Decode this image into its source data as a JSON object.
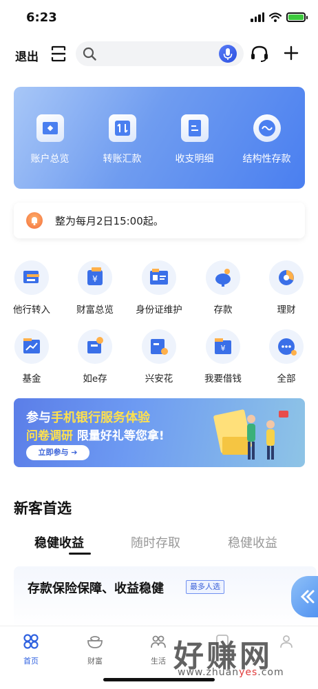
{
  "status": {
    "time": "6:23"
  },
  "header": {
    "logout_label": "退出",
    "search_placeholder": "",
    "icons": [
      "scan-icon",
      "search-icon",
      "mic-icon",
      "headset-icon",
      "plus-icon"
    ]
  },
  "banner": {
    "items": [
      {
        "label": "账户总览",
        "icon": "wallet-icon"
      },
      {
        "label": "转账汇款",
        "icon": "transfer-icon"
      },
      {
        "label": "收支明细",
        "icon": "document-icon"
      },
      {
        "label": "结构性存款",
        "icon": "wave-icon"
      }
    ]
  },
  "notice": {
    "text": "整为每月2日15:00起。",
    "icon": "bell-icon"
  },
  "grid": {
    "items": [
      {
        "label": "他行转入",
        "icon": "bank-transfer-icon"
      },
      {
        "label": "财富总览",
        "icon": "wealth-icon"
      },
      {
        "label": "身份证维护",
        "icon": "id-card-icon"
      },
      {
        "label": "存款",
        "icon": "piggy-bank-icon"
      },
      {
        "label": "理财",
        "icon": "pie-chart-icon"
      },
      {
        "label": "基金",
        "icon": "fund-chart-icon"
      },
      {
        "label": "如e存",
        "icon": "deposit-icon"
      },
      {
        "label": "兴安花",
        "icon": "credit-icon"
      },
      {
        "label": "我要借钱",
        "icon": "loan-icon"
      },
      {
        "label": "全部",
        "icon": "more-icon"
      }
    ]
  },
  "promo": {
    "title_prefix": "参与",
    "title_highlight": "手机银行服务体验",
    "subtitle_part1": "问卷调研",
    "subtitle_part2": "限量好礼等您拿!",
    "button_label": "立即参与 ➔"
  },
  "section": {
    "title": "新客首选",
    "tabs": [
      "稳健收益",
      "随时存取",
      "稳健收益"
    ],
    "active_tab": 0
  },
  "card": {
    "title": "存款保险保障、收益稳健",
    "badge": "最多人选"
  },
  "bottom_nav": {
    "items": [
      {
        "label": "首页",
        "icon": "home-icon",
        "active": true
      },
      {
        "label": "财富",
        "icon": "wealth-bowl-icon",
        "active": false
      },
      {
        "label": "生活",
        "icon": "life-icon",
        "active": false
      },
      {
        "label": "",
        "icon": "discover-icon",
        "active": false
      },
      {
        "label": "",
        "icon": "profile-icon",
        "active": false
      }
    ]
  },
  "watermark": {
    "text": "好赚网",
    "url_prefix": "www.zhuan",
    "url_mid": "yes",
    "url_suffix": ".com"
  },
  "colors": {
    "accent": "#3062e0",
    "banner": "#4a7ff0",
    "highlight": "#ffe14d"
  }
}
